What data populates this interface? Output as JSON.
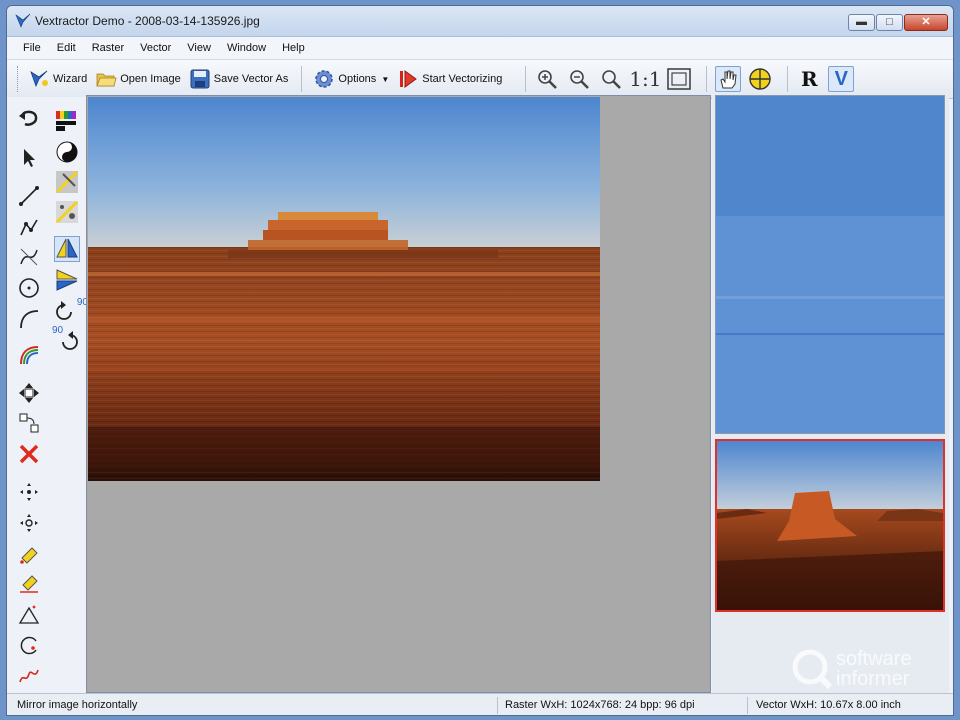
{
  "window": {
    "title": "Vextractor Demo - 2008-03-14-135926.jpg",
    "controls": {
      "minimize": "▬",
      "maximize": "□",
      "close": "✕"
    }
  },
  "menu": [
    "File",
    "Edit",
    "Raster",
    "Vector",
    "View",
    "Window",
    "Help"
  ],
  "toolbar": {
    "wizard": "Wizard",
    "open_image": "Open Image",
    "save_vector": "Save Vector As",
    "options": "Options",
    "start_vectorizing": "Start Vectorizing",
    "zoom_actual": "1:1"
  },
  "left_tools": {
    "rotate_90_label": "90",
    "rotate_neg90_label": "90",
    "active_tool": "mirror-horizontal"
  },
  "view_tools": {
    "active": [
      "pan",
      "vector-mode"
    ],
    "raster_mode_label": "R",
    "vector_mode_label": "V"
  },
  "watermark": {
    "line1": "software",
    "line2": "informer"
  },
  "status": {
    "hint": "Mirror image horizontally",
    "raster": "Raster WxH: 1024x768: 24 bpp: 96 dpi",
    "vector": "Vector WxH: 10.67x 8.00 inch"
  },
  "colors": {
    "accent": "#2b66c7",
    "close": "#c8442c",
    "selection": "#e0302a",
    "canvas_bg": "#a9a9a9"
  }
}
